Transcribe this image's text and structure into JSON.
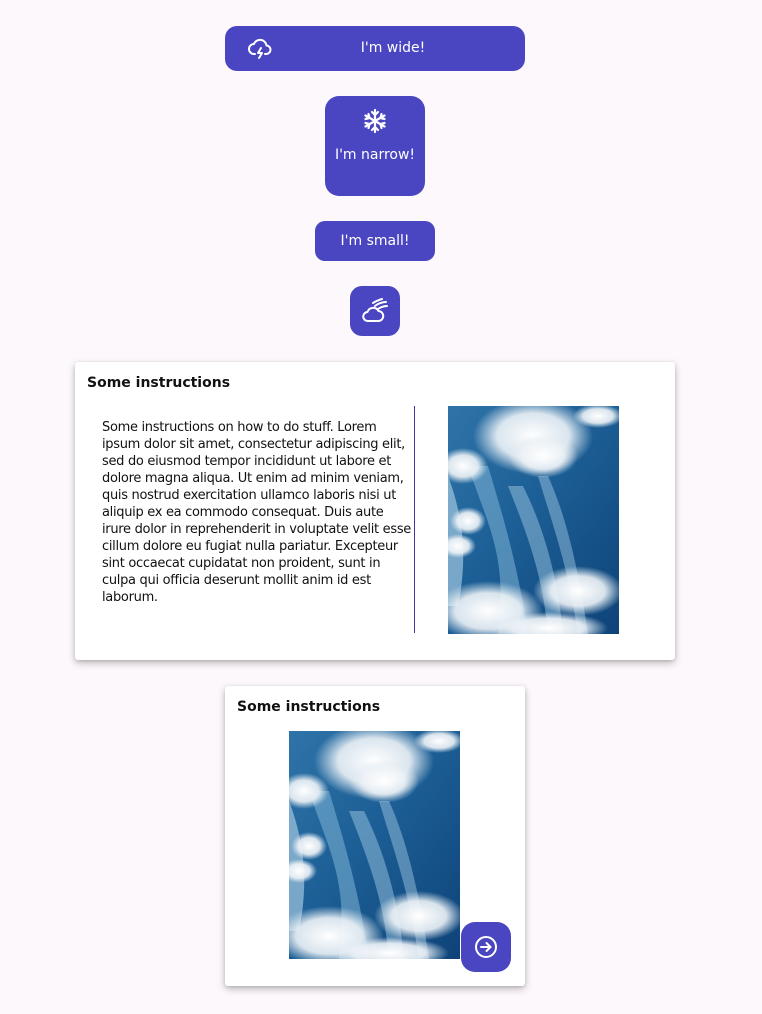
{
  "buttons": {
    "wide": {
      "label": "I'm wide!",
      "icon": "thunderstorm-icon"
    },
    "narrow": {
      "label": "I'm narrow!",
      "icon": "snowflake-icon"
    },
    "small": {
      "label": "I'm small!"
    },
    "icon_only": {
      "icon": "windy-cloud-icon"
    }
  },
  "card_wide": {
    "title": "Some instructions",
    "body": "Some instructions on how to do stuff. Lorem ipsum dolor sit amet, consectetur adipiscing elit, sed do eiusmod tempor incididunt ut labore et dolore magna aliqua. Ut enim ad minim veniam, quis nostrud exercitation ullamco laboris nisi ut aliquip ex ea commodo consequat. Duis aute irure dolor in reprehenderit in voluptate velit esse cillum dolore eu fugiat nulla pariatur. Excepteur sint occaecat cupidatat non proident, sunt in culpa qui officia deserunt mollit anim id est laborum.",
    "image": "sky-clouds-photo"
  },
  "card_narrow": {
    "title": "Some instructions",
    "image": "sky-clouds-photo",
    "action_icon": "arrow-right-circle-icon"
  },
  "colors": {
    "accent": "#4a45c0",
    "background": "#fdf8fc",
    "card": "#ffffff",
    "divider": "#3d3a9e"
  }
}
